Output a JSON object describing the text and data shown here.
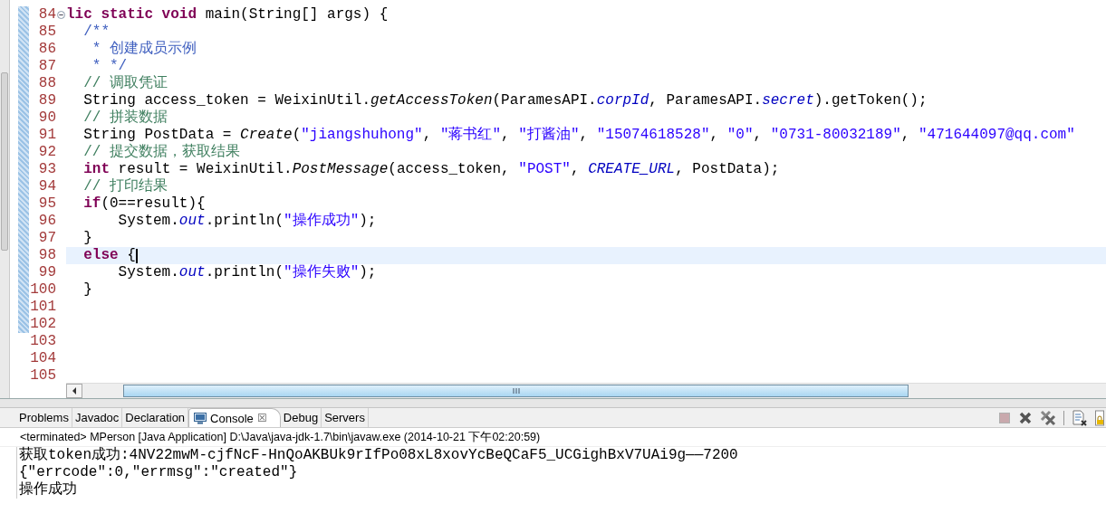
{
  "editor": {
    "lines": [
      {
        "number": "84",
        "current": false,
        "foldable": true,
        "tokens": [
          {
            "kind": "keyword",
            "text": "lic static void"
          },
          {
            "kind": "plain",
            "text": " main(String[] args) {"
          }
        ]
      },
      {
        "number": "85",
        "current": false,
        "foldable": false,
        "tokens": [
          {
            "kind": "doc",
            "text": "  /**"
          }
        ]
      },
      {
        "number": "86",
        "current": false,
        "foldable": false,
        "tokens": [
          {
            "kind": "doc",
            "text": "   * 创建成员示例"
          }
        ]
      },
      {
        "number": "87",
        "current": false,
        "foldable": false,
        "tokens": [
          {
            "kind": "doc",
            "text": "   * */"
          }
        ]
      },
      {
        "number": "88",
        "current": false,
        "foldable": false,
        "tokens": [
          {
            "kind": "comment",
            "text": "  // 调取凭证"
          }
        ]
      },
      {
        "number": "89",
        "current": false,
        "foldable": false,
        "tokens": [
          {
            "kind": "plain",
            "text": "  String access_token = WeixinUtil."
          },
          {
            "kind": "static_method",
            "text": "getAccessToken"
          },
          {
            "kind": "plain",
            "text": "(ParamesAPI."
          },
          {
            "kind": "static_field",
            "text": "corpId"
          },
          {
            "kind": "plain",
            "text": ", ParamesAPI."
          },
          {
            "kind": "static_field",
            "text": "secret"
          },
          {
            "kind": "plain",
            "text": ").getToken();"
          }
        ]
      },
      {
        "number": "90",
        "current": false,
        "foldable": false,
        "tokens": [
          {
            "kind": "comment",
            "text": "  // 拼装数据"
          }
        ]
      },
      {
        "number": "91",
        "current": false,
        "foldable": false,
        "tokens": [
          {
            "kind": "plain",
            "text": "  String PostData = "
          },
          {
            "kind": "static_method",
            "text": "Create"
          },
          {
            "kind": "plain",
            "text": "("
          },
          {
            "kind": "string",
            "text": "\"jiangshuhong\""
          },
          {
            "kind": "plain",
            "text": ", "
          },
          {
            "kind": "string",
            "text": "\"蒋书红\""
          },
          {
            "kind": "plain",
            "text": ", "
          },
          {
            "kind": "string",
            "text": "\"打酱油\""
          },
          {
            "kind": "plain",
            "text": ", "
          },
          {
            "kind": "string",
            "text": "\"15074618528\""
          },
          {
            "kind": "plain",
            "text": ", "
          },
          {
            "kind": "string",
            "text": "\"0\""
          },
          {
            "kind": "plain",
            "text": ", "
          },
          {
            "kind": "string",
            "text": "\"0731-80032189\""
          },
          {
            "kind": "plain",
            "text": ", "
          },
          {
            "kind": "string",
            "text": "\"471644097@qq.com\""
          }
        ]
      },
      {
        "number": "92",
        "current": false,
        "foldable": false,
        "tokens": [
          {
            "kind": "comment",
            "text": "  // 提交数据，获取结果"
          }
        ]
      },
      {
        "number": "93",
        "current": false,
        "foldable": false,
        "tokens": [
          {
            "kind": "keyword",
            "text": "  int"
          },
          {
            "kind": "plain",
            "text": " result = WeixinUtil."
          },
          {
            "kind": "static_method",
            "text": "PostMessage"
          },
          {
            "kind": "plain",
            "text": "(access_token, "
          },
          {
            "kind": "string",
            "text": "\"POST\""
          },
          {
            "kind": "plain",
            "text": ", "
          },
          {
            "kind": "static_field",
            "text": "CREATE_URL"
          },
          {
            "kind": "plain",
            "text": ", PostData);"
          }
        ]
      },
      {
        "number": "94",
        "current": false,
        "foldable": false,
        "tokens": [
          {
            "kind": "comment",
            "text": "  // 打印结果"
          }
        ]
      },
      {
        "number": "95",
        "current": false,
        "foldable": false,
        "tokens": [
          {
            "kind": "keyword",
            "text": "  if"
          },
          {
            "kind": "plain",
            "text": "(0==result){"
          }
        ]
      },
      {
        "number": "96",
        "current": false,
        "foldable": false,
        "tokens": [
          {
            "kind": "plain",
            "text": "      System."
          },
          {
            "kind": "static_field",
            "text": "out"
          },
          {
            "kind": "plain",
            "text": ".println("
          },
          {
            "kind": "string",
            "text": "\"操作成功\""
          },
          {
            "kind": "plain",
            "text": ");"
          }
        ]
      },
      {
        "number": "97",
        "current": false,
        "foldable": false,
        "tokens": [
          {
            "kind": "plain",
            "text": "  }"
          }
        ]
      },
      {
        "number": "98",
        "current": true,
        "foldable": false,
        "tokens": [
          {
            "kind": "keyword",
            "text": "  else"
          },
          {
            "kind": "plain",
            "text": " {"
          }
        ]
      },
      {
        "number": "99",
        "current": false,
        "foldable": false,
        "tokens": [
          {
            "kind": "plain",
            "text": "      System."
          },
          {
            "kind": "static_field",
            "text": "out"
          },
          {
            "kind": "plain",
            "text": ".println("
          },
          {
            "kind": "string",
            "text": "\"操作失败\""
          },
          {
            "kind": "plain",
            "text": ");"
          }
        ]
      },
      {
        "number": "100",
        "current": false,
        "foldable": false,
        "tokens": [
          {
            "kind": "plain",
            "text": "  }"
          }
        ]
      },
      {
        "number": "101",
        "current": false,
        "foldable": false
      },
      {
        "number": "102",
        "current": false,
        "foldable": false
      },
      {
        "number": "103",
        "current": false,
        "foldable": false
      },
      {
        "number": "104",
        "current": false,
        "foldable": false
      },
      {
        "number": "105",
        "current": false,
        "foldable": false
      }
    ]
  },
  "panel": {
    "tabs": [
      {
        "label": "Problems",
        "selected": false
      },
      {
        "label": "Javadoc",
        "selected": false
      },
      {
        "label": "Declaration",
        "selected": false
      },
      {
        "label": "Console",
        "selected": true,
        "close": "☒"
      },
      {
        "label": "Debug",
        "selected": false
      },
      {
        "label": "Servers",
        "selected": false
      }
    ],
    "description": "<terminated> MPerson [Java Application] D:\\Java\\java-jdk-1.7\\bin\\javaw.exe (2014-10-21 下午02:20:59)",
    "output": [
      "获取token成功:4NV22mwM-cjfNcF-HnQoAKBUk9rIfPo08xL8xovYcBeQCaF5_UCGighBxV7UAi9g——7200",
      "{\"errcode\":0,\"errmsg\":\"created\"}",
      "操作成功"
    ]
  }
}
